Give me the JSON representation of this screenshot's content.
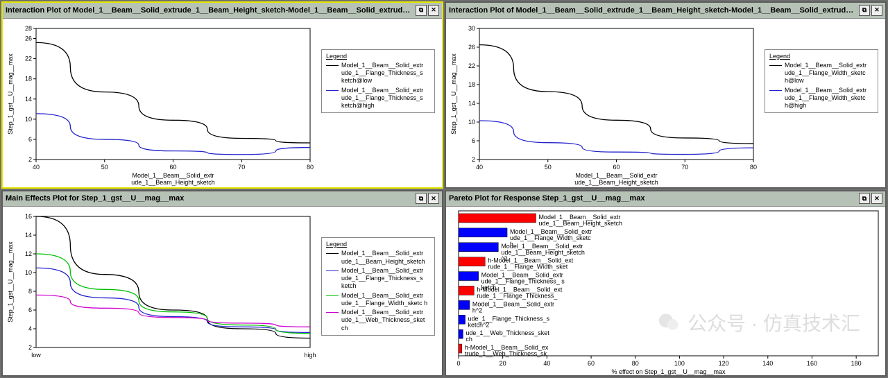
{
  "panels": {
    "tl": {
      "title": "Interaction Plot of Model_1__Beam__Solid_extrude_1__Beam_Height_sketch-Model_1__Beam__Solid_extrude_1..."
    },
    "tr": {
      "title": "Interaction Plot of Model_1__Beam__Solid_extrude_1__Beam_Height_sketch-Model_1__Beam__Solid_extrude_1__F..."
    },
    "bl": {
      "title": "Main Effects Plot for Step_1_gst__U__mag__max"
    },
    "br": {
      "title": "Pareto Plot for Response Step_1_gst__U__mag__max"
    }
  },
  "icons": {
    "restore": "⧉",
    "close": "✕"
  },
  "chart_data": [
    {
      "id": "tl",
      "type": "line",
      "title": "",
      "xlabel": "Model_1__Beam__Solid_extr\nude_1__Beam_Height_sketch",
      "ylabel": "Step_1_gst__U__mag__max",
      "x": [
        40,
        50,
        60,
        70,
        80
      ],
      "xlim": [
        40,
        80
      ],
      "ylim": [
        2,
        28
      ],
      "yticks": [
        2,
        6,
        10,
        14,
        18,
        22,
        26,
        28
      ],
      "legend_title": "Legend",
      "series": [
        {
          "name": "Model_1__Beam__Solid_extr ude_1__Flange_Thickness_s ketch@low",
          "color": "#000000",
          "values": [
            25.2,
            15.4,
            9.8,
            6.2,
            5.3
          ]
        },
        {
          "name": "Model_1__Beam__Solid_extr ude_1__Flange_Thickness_s ketch@high",
          "color": "#2222cc",
          "values": [
            11.1,
            6.0,
            3.7,
            3.0,
            4.4
          ]
        }
      ]
    },
    {
      "id": "tr",
      "type": "line",
      "title": "",
      "xlabel": "Model_1__Beam__Solid_extr\nude_1__Beam_Height_sketch",
      "ylabel": "Step_1_gst__U__mag__max",
      "x": [
        40,
        50,
        60,
        70,
        80
      ],
      "xlim": [
        40,
        80
      ],
      "ylim": [
        2,
        30
      ],
      "yticks": [
        2,
        6,
        10,
        14,
        18,
        22,
        26,
        30
      ],
      "legend_title": "Legend",
      "series": [
        {
          "name": "Model_1__Beam__Solid_extr ude_1__Flange_Width_sketc h@low",
          "color": "#000000",
          "values": [
            26.5,
            16.5,
            10.4,
            6.6,
            5.4
          ]
        },
        {
          "name": "Model_1__Beam__Solid_extr ude_1__Flange_Width_sketc h@high",
          "color": "#2222cc",
          "values": [
            10.3,
            5.6,
            3.6,
            3.1,
            4.5
          ]
        }
      ]
    },
    {
      "id": "bl",
      "type": "line",
      "title": "",
      "xlabel": "",
      "ylabel": "Step_1_gst__U__mag__max",
      "x_categories": [
        "low",
        "high"
      ],
      "xlim": [
        0,
        1
      ],
      "ylim": [
        2,
        16
      ],
      "yticks": [
        2,
        4,
        6,
        8,
        10,
        12,
        14,
        16
      ],
      "legend_title": "Legend",
      "series": [
        {
          "name": "Model_1__Beam__Solid_extr ude_1__Beam_Height_sketch",
          "color": "#000000",
          "xs": [
            0,
            0.25,
            0.5,
            0.75,
            1
          ],
          "values": [
            16.0,
            9.8,
            6.0,
            4.0,
            3.0
          ]
        },
        {
          "name": "Model_1__Beam__Solid_extr ude_1__Flange_Thickness_s ketch",
          "color": "#2222cc",
          "xs": [
            0,
            0.25,
            0.5,
            0.75,
            1
          ],
          "values": [
            10.5,
            7.3,
            5.3,
            4.2,
            3.6
          ]
        },
        {
          "name": "Model_1__Beam__Solid_extr ude_1__Flange_Width_sketc h",
          "color": "#00c000",
          "xs": [
            0,
            0.25,
            0.5,
            0.75,
            1
          ],
          "values": [
            12.0,
            8.2,
            5.8,
            4.4,
            3.5
          ]
        },
        {
          "name": "Model_1__Beam__Solid_extr ude_1__Web_Thickness_sket ch",
          "color": "#d000d0",
          "xs": [
            0,
            0.25,
            0.5,
            0.75,
            1
          ],
          "values": [
            7.6,
            6.2,
            5.2,
            4.6,
            4.2
          ]
        }
      ]
    },
    {
      "id": "br",
      "type": "bar",
      "orientation": "h",
      "xlabel": "% effect on Step_1_gst__U__mag__max",
      "xlim": [
        0,
        190
      ],
      "xticks": [
        0,
        20,
        40,
        60,
        80,
        100,
        120,
        140,
        160,
        180
      ],
      "bars": [
        {
          "label": "Model_1__Beam__Solid_extr\nude_1__Beam_Height_sketch",
          "value": 35,
          "color": "#ff0000"
        },
        {
          "label": "Model_1__Beam__Solid_extr\nude_1__Flange_Width_sketc\nh",
          "value": 22,
          "color": "#0000ff"
        },
        {
          "label": "Model_1__Beam__Solid_extr\nude_1__Beam_Height_sketch\n^2",
          "value": 18,
          "color": "#0000ff"
        },
        {
          "label": "h-Model_1__Beam__Solid_ext\nrude_1__Flange_Width_sket",
          "value": 12,
          "color": "#ff0000"
        },
        {
          "label": "Model_1__Beam__Solid_extr\nude_1__Flange_Thickness_ s\nketch",
          "value": 9,
          "color": "#0000ff"
        },
        {
          "label": "h-Model_1__Beam__Solid_ext\nrude_1__Flange_Thickness_",
          "value": 7,
          "color": "#ff0000"
        },
        {
          "label": "Model_1__Beam__Solid_extr\nh^2",
          "value": 5,
          "color": "#0000ff"
        },
        {
          "label": "ude_1__Flange_Thickness_s\nketch^2",
          "value": 3,
          "color": "#0000ff"
        },
        {
          "label": "ude_1__Web_Thickness_sket\nch",
          "value": 2,
          "color": "#0000ff"
        },
        {
          "label": "h-Model_1__Beam__Solid_ex\ntrude_1__Web_Thickness_sk",
          "value": 1.5,
          "color": "#ff0000"
        }
      ]
    }
  ],
  "watermark": "公众号 · 仿真技术汇"
}
